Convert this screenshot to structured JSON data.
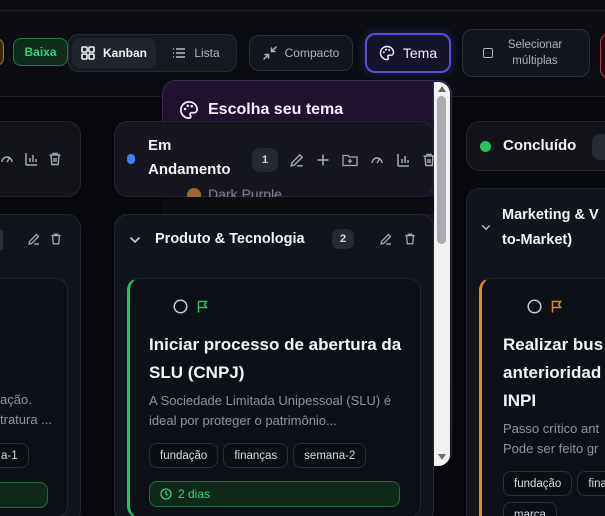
{
  "toolbar": {
    "priority_low": "Baixa",
    "view_kanban": "Kanban",
    "view_list": "Lista",
    "compact": "Compacto",
    "theme": "Tema",
    "select_multiple": "Selecionar múltiplas"
  },
  "theme_popup": {
    "title": "Escolha seu tema",
    "item_partial": "Dark Purple"
  },
  "columns": {
    "in_progress": {
      "title": "Em Andamento",
      "count": "1",
      "status_color": "#3b82f6"
    },
    "done": {
      "title": "Concluído",
      "status_color": "#22c55e"
    }
  },
  "groups": {
    "product_tech": {
      "title": "Produto & Tecnologia",
      "count": "2"
    },
    "marketing": {
      "title": "Marketing & Go-to-Market)",
      "line1": "Marketing & V",
      "line2": "to-Market)"
    }
  },
  "tasks": {
    "left_partial": {
      "desc1": "ação.",
      "desc2": "tratura ...",
      "tag": "a-1"
    },
    "slu": {
      "title": "Iniciar processo de abertura da SLU (CNPJ)",
      "description": "A Sociedade Limitada Unipessoal (SLU) é ideal por proteger o patrimônio...",
      "tags": [
        "fundação",
        "finanças",
        "semana-2"
      ],
      "time": "2 dias"
    },
    "inpi": {
      "title_l1": "Realizar bus",
      "title_l2": "anterioridad",
      "title_l3": "INPI",
      "desc1": "Passo crítico ant",
      "desc2": "Pode ser feito gr",
      "tags": [
        "fundação",
        "fina"
      ],
      "tag3": "marca"
    }
  },
  "colors": {
    "accent_purple": "#5b4bd6",
    "success": "#22c55e",
    "warning": "#e08a1e",
    "info": "#3b82f6"
  }
}
